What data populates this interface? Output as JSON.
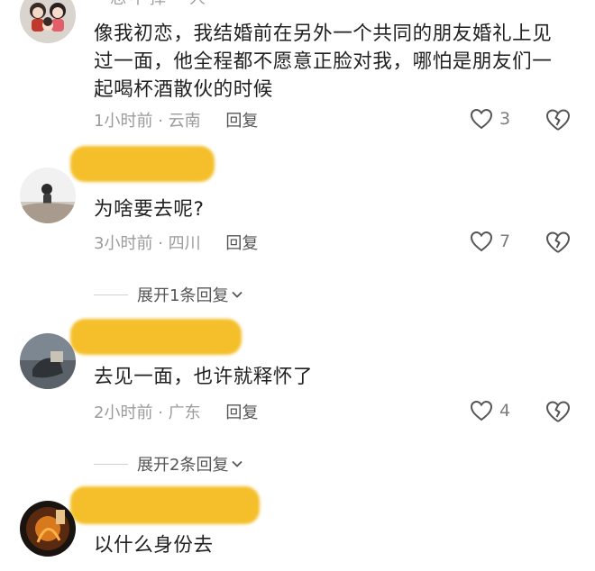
{
  "comments": [
    {
      "username_visible": "忘不掉一人",
      "text": "像我初恋，我结婚前在另外一个共同的朋友婚礼上见过一面，他全程都不愿意正脸对我，哪怕是朋友们一起喝杯酒散伙的时候",
      "time": "1小时前",
      "location": "云南",
      "reply_label": "回复",
      "likes": "3"
    },
    {
      "text": "为啥要去呢?",
      "time": "3小时前",
      "location": "四川",
      "reply_label": "回复",
      "likes": "7",
      "expand_label": "展开1条回复"
    },
    {
      "text": "去见一面，也许就释怀了",
      "time": "2小时前",
      "location": "广东",
      "reply_label": "回复",
      "likes": "4",
      "expand_label": "展开2条回复"
    },
    {
      "text": "以什么身份去"
    }
  ],
  "icons": {
    "like": "heart-outline-icon",
    "dislike": "broken-heart-icon",
    "expand": "chevron-down-icon"
  },
  "colors": {
    "username_redaction": "#f4bf2a",
    "meta_text": "#9b9b9b",
    "reply_text": "#555555",
    "icon_stroke": "#555555"
  }
}
